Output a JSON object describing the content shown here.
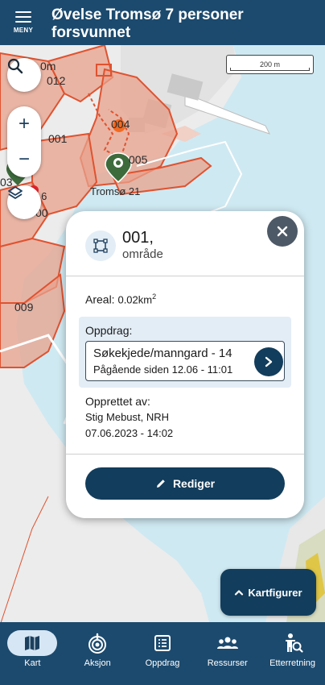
{
  "header": {
    "menu_label": "MENY",
    "title": "Øvelse Tromsø 7 personer forsvunnet"
  },
  "map": {
    "scale_label": "200 m",
    "labels": {
      "l012": "012",
      "l001": "001",
      "l009": "009",
      "l005": "005",
      "l004": "004",
      "tromso21": "Tromsø 21",
      "l0m": "0m",
      "l03": "03",
      "lro6": "ro 6",
      "l00": "00"
    }
  },
  "popup": {
    "title": "001,",
    "subtitle": "område",
    "areal_label": "Areal:",
    "areal_value": "0.02km",
    "areal_exp": "2",
    "oppdrag_label": "Oppdrag:",
    "oppdrag_name": "Søkekjede/manngard - 14",
    "oppdrag_status": "Pågående siden 12.06 - 11:01",
    "created_label": "Opprettet av:",
    "created_by": "Stig Mebust, NRH",
    "created_at": "07.06.2023 - 14:02",
    "edit_label": "Rediger"
  },
  "kartfigurer_label": "Kartfigurer",
  "nav": {
    "items": [
      {
        "label": "Kart",
        "icon": "map-icon"
      },
      {
        "label": "Aksjon",
        "icon": "target-icon"
      },
      {
        "label": "Oppdrag",
        "icon": "list-icon"
      },
      {
        "label": "Ressurser",
        "icon": "group-icon"
      },
      {
        "label": "Etterretning",
        "icon": "person-search-icon"
      }
    ]
  },
  "colors": {
    "primary": "#1c4a6e",
    "button": "#123d5c",
    "area_fill": "#e8a18c",
    "area_stroke": "#e0522f",
    "water": "#cfe9f2"
  }
}
